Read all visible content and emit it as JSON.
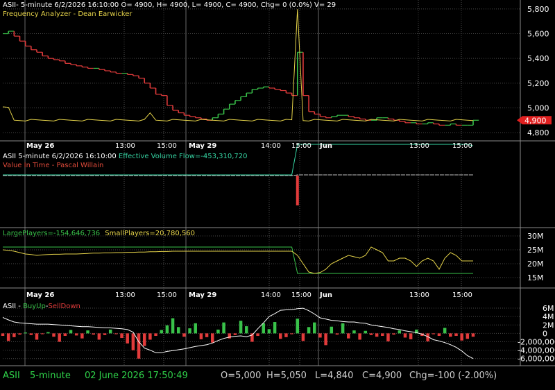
{
  "colors": {
    "up": "#39c24a",
    "down": "#e23b3b",
    "frequency": "#e6d44a",
    "evf": "#36d6a4",
    "large": "#39c24a",
    "small": "#e6d44a",
    "grid": "#4a4a4a",
    "axis_text": "#ffffff",
    "bg": "#000000",
    "price_tag": "#e02020"
  },
  "panel1": {
    "line1": "ASII- 5-minute 6/2/2026 16:10:00 O= 4900, H= 4900, L= 4900, C= 4900, Chg= 0 (0.0%) V= 29",
    "line2": "Frequency Analyzer - Dean Earwicker",
    "last_price_tag": "4,900"
  },
  "panel2": {
    "line1_prefix": "ASII 5-minute 6/2/2026 16:10:00",
    "line1_evf": "Effective Volume Flow=-453,310,720",
    "line2": "Value In Time - Pascal Willain"
  },
  "panel3": {
    "large_label": "LargePlayers=-154,646,736",
    "small_label": "SmallPlayers=20,780,560"
  },
  "panel4": {
    "prefix": "ASII - ",
    "buy": "BuyUp",
    "dash": "-",
    "sell": "SellDown"
  },
  "status": {
    "symbol": "ASII",
    "interval": "5-minute",
    "datetime": "02 June 2026 17:50:49",
    "open": "O=5,000",
    "high": "H=5,050",
    "low": "L=4,840",
    "close": "C=4,900",
    "change": "Chg=-100 (-2.00%)"
  },
  "chart_data": [
    {
      "type": "line",
      "title": "ASII- 5-minute price with Frequency Analyzer",
      "x_labels": [
        "May 26",
        "13:00",
        "15:00",
        "May 29",
        "14:00",
        "15:00",
        "Jun",
        "13:00",
        "15:00"
      ],
      "y_ticks": [
        "5,800",
        "5,600",
        "5,400",
        "5,200",
        "5,000",
        "4,800"
      ],
      "y_tick_values": [
        5800,
        5600,
        5400,
        5200,
        5000,
        4800
      ],
      "ylim": [
        4750,
        5850
      ],
      "series": [
        {
          "name": "ASII",
          "values": [
            5600,
            5620,
            5580,
            5540,
            5500,
            5470,
            5450,
            5420,
            5400,
            5390,
            5380,
            5360,
            5350,
            5340,
            5330,
            5320,
            5320,
            5310,
            5300,
            5290,
            5280,
            5280,
            5270,
            5260,
            5240,
            5200,
            5160,
            5110,
            5100,
            5020,
            4980,
            4960,
            4940,
            4930,
            4920,
            4910,
            4900,
            4920,
            4950,
            4990,
            5030,
            5060,
            5090,
            5120,
            5150,
            5160,
            5170,
            5160,
            5150,
            5140,
            5120,
            5100,
            5450,
            5100,
            4970,
            4950,
            4930,
            4920,
            4930,
            4940,
            4940,
            4930,
            4920,
            4910,
            4900,
            4900,
            4920,
            4920,
            4910,
            4900,
            4890,
            4880,
            4880,
            4870,
            4870,
            4880,
            4870,
            4860,
            4860,
            4870,
            4860,
            4860,
            4860,
            4900
          ]
        }
      ]
    },
    {
      "type": "line",
      "title": "Effective Volume Flow",
      "y_ticks": [],
      "series": [
        {
          "name": "Effective Volume Flow",
          "values": [
            0.0,
            0.0,
            0.0,
            0.0,
            0.0,
            0.0,
            0.0,
            0.0,
            0.0,
            0.0,
            0.0,
            0.0,
            0.0,
            0.0,
            0.0,
            0.0,
            0.0,
            0.0,
            0.0,
            0.0,
            0.0,
            0.0,
            0.0,
            0.0,
            0.0,
            0.0,
            0.0,
            0.0,
            0.0,
            0.0,
            0.0,
            0.0,
            0.0,
            0.0,
            0.0,
            0.0,
            0.0,
            0.0,
            0.0,
            0.0,
            0.0,
            0.0,
            0.0,
            0.0,
            0.0,
            0.0,
            0.0,
            0.0,
            0.0,
            0.0,
            0.0,
            0.0,
            -1.0,
            -1.0,
            -1.0,
            -1.0,
            -1.0,
            -1.0,
            -1.0,
            -1.0,
            -1.0,
            -1.0,
            -1.0,
            -1.0,
            -1.0,
            -1.0,
            -1.0,
            -1.0,
            -1.0,
            -1.0,
            -1.0,
            -1.0,
            -1.0,
            -1.0,
            -1.0,
            -1.0,
            -1.0,
            -1.0,
            -1.0,
            -1.0,
            -1.0,
            -1.0,
            -1.0,
            -0.95
          ]
        }
      ]
    },
    {
      "type": "line",
      "title": "",
      "y_ticks": [
        "30M",
        "25M",
        "20M",
        "15M"
      ],
      "y_tick_values": [
        30,
        25,
        20,
        15
      ],
      "ylim": [
        12,
        32
      ],
      "series": [
        {
          "name": "LargePlayers",
          "values": [
            26,
            26,
            26,
            26,
            26,
            26,
            26,
            26,
            26,
            26,
            26,
            26,
            26,
            26,
            26,
            26,
            26,
            26,
            26,
            26,
            26,
            26,
            26,
            26,
            26,
            26,
            26,
            26,
            26,
            26,
            26,
            26,
            26,
            26,
            26,
            26,
            26,
            26,
            26,
            26,
            26,
            26,
            26,
            26,
            26,
            26,
            26,
            26,
            26,
            26,
            26,
            26,
            16.5,
            16.5,
            16.5,
            16.5,
            16.5,
            16.5,
            16.5,
            16.5,
            16.5,
            16.5,
            16.5,
            16.5,
            16.5,
            16.5,
            16.5,
            16.5,
            16.5,
            16.5,
            16.5,
            16.5,
            16.5,
            16.5,
            16.5,
            16.5,
            16.5,
            16.5,
            16.5,
            16.5,
            16.5,
            16.5,
            16.5,
            16.5
          ]
        },
        {
          "name": "SmallPlayers",
          "values": [
            25,
            24.8,
            24.5,
            24,
            23.5,
            23.3,
            23,
            23.2,
            23.3,
            23.4,
            23.4,
            23.5,
            23.5,
            23.5,
            23.6,
            23.7,
            23.8,
            23.8,
            23.9,
            23.9,
            24,
            24,
            24.1,
            24.1,
            24.2,
            24.2,
            24.3,
            24.3,
            24.4,
            24.4,
            24.5,
            24.5,
            24.5,
            24.5,
            24.5,
            24.5,
            24.5,
            24.5,
            24.5,
            24.5,
            24.5,
            24.5,
            24.5,
            24.5,
            24.5,
            24.5,
            24.5,
            24.5,
            24.5,
            24.5,
            24.5,
            24.5,
            23,
            20,
            17,
            16.5,
            16.8,
            18,
            20,
            21,
            22,
            23,
            22.5,
            22,
            23,
            26,
            25,
            24,
            21,
            21,
            22,
            22,
            21,
            19,
            21,
            22,
            21,
            18,
            22,
            24,
            23,
            21,
            21,
            21
          ]
        }
      ]
    },
    {
      "type": "bar",
      "title": "BuyUp-SellDown",
      "y_ticks": [
        "6M",
        "4M",
        "2M",
        "0",
        "-2,000,000",
        "-4,000,000",
        "-6,000,000"
      ],
      "y_tick_values": [
        6000000,
        4000000,
        2000000,
        0,
        -2000000,
        -4000000,
        -6000000
      ],
      "ylim": [
        -7200000,
        7000000
      ],
      "series": [
        {
          "name": "BuyUp-SellDown",
          "values": [
            -600000,
            -1800000,
            -900000,
            -300000,
            200000,
            -400000,
            -1500000,
            -200000,
            300000,
            -800000,
            -2000000,
            -600000,
            800000,
            -500000,
            -1200000,
            700000,
            -300000,
            -1500000,
            -400000,
            900000,
            -200000,
            -1100000,
            -2400000,
            -4000000,
            -6000000,
            -3000000,
            -1500000,
            -600000,
            800000,
            1900000,
            3600000,
            1500000,
            -800000,
            1200000,
            2400000,
            -1400000,
            -900000,
            -2200000,
            900000,
            2600000,
            -1200000,
            -400000,
            3000000,
            1700000,
            -2000000,
            -600000,
            2400000,
            1000000,
            2700000,
            -1300000,
            -900000,
            -200000,
            3500000,
            -1800000,
            1500000,
            2600000,
            -1000000,
            -2800000,
            1600000,
            -300000,
            2400000,
            -1200000,
            700000,
            -1500000,
            600000,
            -400000,
            -800000,
            -600000,
            -1900000,
            -300000,
            700000,
            -1000000,
            -1400000,
            900000,
            -600000,
            -1900000,
            -200000,
            -600000,
            1300000,
            -800000,
            -600000,
            -1700000,
            -1300000,
            -800000
          ]
        },
        {
          "name": "Cumulative",
          "values": [
            3800000,
            3200000,
            2700000,
            2500000,
            2400000,
            2300000,
            2200000,
            2200000,
            2200000,
            2100000,
            2000000,
            1900000,
            1800000,
            1700000,
            1600000,
            1600000,
            1500000,
            1400000,
            1300000,
            1300000,
            1200000,
            1100000,
            900000,
            300000,
            -2000000,
            -3500000,
            -4000000,
            -4600000,
            -4600000,
            -4300000,
            -4100000,
            -3900000,
            -3700000,
            -3400000,
            -3100000,
            -2900000,
            -2700000,
            -2300000,
            -1700000,
            -1200000,
            -900000,
            -700000,
            -600000,
            -800000,
            -400000,
            1100000,
            2500000,
            4000000,
            4700000,
            5500000,
            5600000,
            5600000,
            5900000,
            6000000,
            5400000,
            4600000,
            3700000,
            3400000,
            3100000,
            3000000,
            2800000,
            2700000,
            2700000,
            2500000,
            2400000,
            2000000,
            1800000,
            1600000,
            1400000,
            1100000,
            900000,
            600000,
            400000,
            200000,
            -200000,
            -800000,
            -1500000,
            -1800000,
            -2200000,
            -2700000,
            -3300000,
            -4200000,
            -5300000,
            -6000000
          ]
        }
      ]
    }
  ]
}
